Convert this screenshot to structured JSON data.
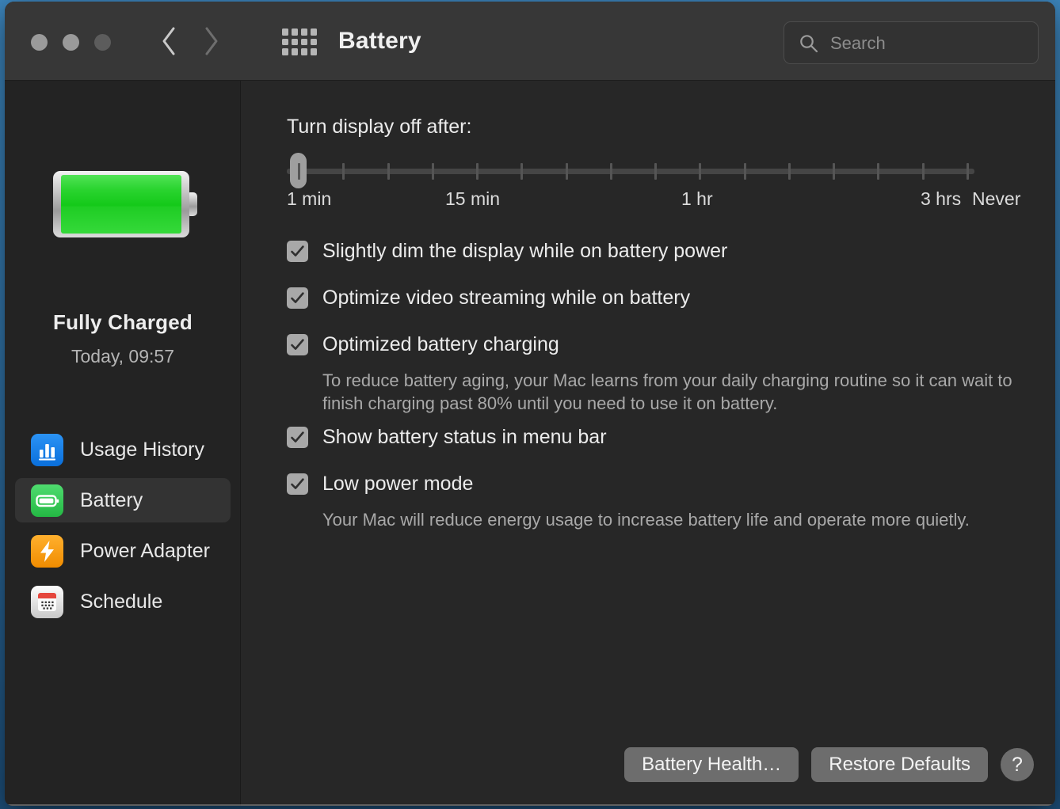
{
  "window": {
    "title": "Battery",
    "traffic_lights": [
      "close-button",
      "minimize-button",
      "zoom-button"
    ],
    "back_label": "Back",
    "forward_label": "Forward",
    "grid_label": "Show All Preferences"
  },
  "search": {
    "placeholder": "Search",
    "value": "",
    "icon": "search-icon"
  },
  "sidebar": {
    "battery_graphic": "battery-full-icon",
    "status_title": "Fully Charged",
    "status_subtitle": "Today, 09:57",
    "items": [
      {
        "label": "Usage History",
        "icon": "usage-history-icon",
        "color": "#1a82f0",
        "selected": false
      },
      {
        "label": "Battery",
        "icon": "battery-icon",
        "color": "#35c759",
        "selected": true
      },
      {
        "label": "Power Adapter",
        "icon": "power-adapter-icon",
        "color": "#f59a12",
        "selected": false
      },
      {
        "label": "Schedule",
        "icon": "schedule-icon",
        "color": "#e8e8e8",
        "selected": false
      }
    ]
  },
  "main": {
    "slider": {
      "label": "Turn display off after:",
      "value": "1 min",
      "tick_count": 16,
      "tick_labels": [
        {
          "text": "1 min",
          "pos": 0
        },
        {
          "text": "15 min",
          "pos": 200
        },
        {
          "text": "1 hr",
          "pos": 498
        },
        {
          "text": "3 hrs",
          "pos": 800
        },
        {
          "text": "Never",
          "pos": 865
        }
      ]
    },
    "options": [
      {
        "label": "Slightly dim the display while on battery power",
        "checked": true,
        "description": null
      },
      {
        "label": "Optimize video streaming while on battery",
        "checked": true,
        "description": null
      },
      {
        "label": "Optimized battery charging",
        "checked": true,
        "description": "To reduce battery aging, your Mac learns from your daily charging routine so it can wait to finish charging past 80% until you need to use it on battery."
      },
      {
        "label": "Show battery status in menu bar",
        "checked": true,
        "description": null
      },
      {
        "label": "Low power mode",
        "checked": true,
        "description": "Your Mac will reduce energy usage to increase battery life and operate more quietly."
      }
    ],
    "footer": {
      "battery_health_label": "Battery Health…",
      "restore_defaults_label": "Restore Defaults",
      "help_label": "?"
    }
  },
  "colors": {
    "window_bg": "#272727",
    "sidebar_bg": "#232323",
    "titlebar_bg": "#373737",
    "accent_green": "#35c759",
    "accent_blue": "#1a82f0",
    "accent_orange": "#f59a12",
    "accent_red": "#e8493f",
    "desktop": "#3a7fb5"
  }
}
